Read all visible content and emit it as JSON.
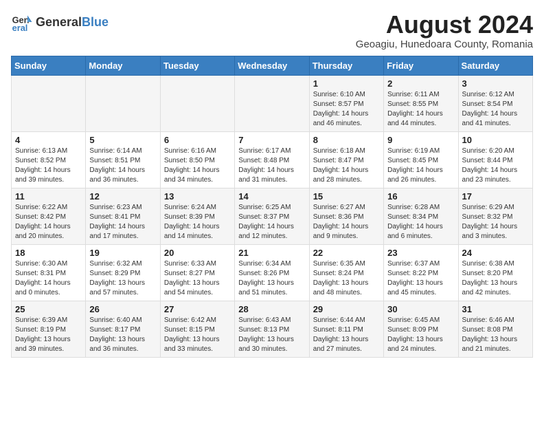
{
  "header": {
    "logo_general": "General",
    "logo_blue": "Blue",
    "month_year": "August 2024",
    "location": "Geoagiu, Hunedoara County, Romania"
  },
  "weekdays": [
    "Sunday",
    "Monday",
    "Tuesday",
    "Wednesday",
    "Thursday",
    "Friday",
    "Saturday"
  ],
  "weeks": [
    [
      {
        "day": "",
        "info": ""
      },
      {
        "day": "",
        "info": ""
      },
      {
        "day": "",
        "info": ""
      },
      {
        "day": "",
        "info": ""
      },
      {
        "day": "1",
        "info": "Sunrise: 6:10 AM\nSunset: 8:57 PM\nDaylight: 14 hours\nand 46 minutes."
      },
      {
        "day": "2",
        "info": "Sunrise: 6:11 AM\nSunset: 8:55 PM\nDaylight: 14 hours\nand 44 minutes."
      },
      {
        "day": "3",
        "info": "Sunrise: 6:12 AM\nSunset: 8:54 PM\nDaylight: 14 hours\nand 41 minutes."
      }
    ],
    [
      {
        "day": "4",
        "info": "Sunrise: 6:13 AM\nSunset: 8:52 PM\nDaylight: 14 hours\nand 39 minutes."
      },
      {
        "day": "5",
        "info": "Sunrise: 6:14 AM\nSunset: 8:51 PM\nDaylight: 14 hours\nand 36 minutes."
      },
      {
        "day": "6",
        "info": "Sunrise: 6:16 AM\nSunset: 8:50 PM\nDaylight: 14 hours\nand 34 minutes."
      },
      {
        "day": "7",
        "info": "Sunrise: 6:17 AM\nSunset: 8:48 PM\nDaylight: 14 hours\nand 31 minutes."
      },
      {
        "day": "8",
        "info": "Sunrise: 6:18 AM\nSunset: 8:47 PM\nDaylight: 14 hours\nand 28 minutes."
      },
      {
        "day": "9",
        "info": "Sunrise: 6:19 AM\nSunset: 8:45 PM\nDaylight: 14 hours\nand 26 minutes."
      },
      {
        "day": "10",
        "info": "Sunrise: 6:20 AM\nSunset: 8:44 PM\nDaylight: 14 hours\nand 23 minutes."
      }
    ],
    [
      {
        "day": "11",
        "info": "Sunrise: 6:22 AM\nSunset: 8:42 PM\nDaylight: 14 hours\nand 20 minutes."
      },
      {
        "day": "12",
        "info": "Sunrise: 6:23 AM\nSunset: 8:41 PM\nDaylight: 14 hours\nand 17 minutes."
      },
      {
        "day": "13",
        "info": "Sunrise: 6:24 AM\nSunset: 8:39 PM\nDaylight: 14 hours\nand 14 minutes."
      },
      {
        "day": "14",
        "info": "Sunrise: 6:25 AM\nSunset: 8:37 PM\nDaylight: 14 hours\nand 12 minutes."
      },
      {
        "day": "15",
        "info": "Sunrise: 6:27 AM\nSunset: 8:36 PM\nDaylight: 14 hours\nand 9 minutes."
      },
      {
        "day": "16",
        "info": "Sunrise: 6:28 AM\nSunset: 8:34 PM\nDaylight: 14 hours\nand 6 minutes."
      },
      {
        "day": "17",
        "info": "Sunrise: 6:29 AM\nSunset: 8:32 PM\nDaylight: 14 hours\nand 3 minutes."
      }
    ],
    [
      {
        "day": "18",
        "info": "Sunrise: 6:30 AM\nSunset: 8:31 PM\nDaylight: 14 hours\nand 0 minutes."
      },
      {
        "day": "19",
        "info": "Sunrise: 6:32 AM\nSunset: 8:29 PM\nDaylight: 13 hours\nand 57 minutes."
      },
      {
        "day": "20",
        "info": "Sunrise: 6:33 AM\nSunset: 8:27 PM\nDaylight: 13 hours\nand 54 minutes."
      },
      {
        "day": "21",
        "info": "Sunrise: 6:34 AM\nSunset: 8:26 PM\nDaylight: 13 hours\nand 51 minutes."
      },
      {
        "day": "22",
        "info": "Sunrise: 6:35 AM\nSunset: 8:24 PM\nDaylight: 13 hours\nand 48 minutes."
      },
      {
        "day": "23",
        "info": "Sunrise: 6:37 AM\nSunset: 8:22 PM\nDaylight: 13 hours\nand 45 minutes."
      },
      {
        "day": "24",
        "info": "Sunrise: 6:38 AM\nSunset: 8:20 PM\nDaylight: 13 hours\nand 42 minutes."
      }
    ],
    [
      {
        "day": "25",
        "info": "Sunrise: 6:39 AM\nSunset: 8:19 PM\nDaylight: 13 hours\nand 39 minutes."
      },
      {
        "day": "26",
        "info": "Sunrise: 6:40 AM\nSunset: 8:17 PM\nDaylight: 13 hours\nand 36 minutes."
      },
      {
        "day": "27",
        "info": "Sunrise: 6:42 AM\nSunset: 8:15 PM\nDaylight: 13 hours\nand 33 minutes."
      },
      {
        "day": "28",
        "info": "Sunrise: 6:43 AM\nSunset: 8:13 PM\nDaylight: 13 hours\nand 30 minutes."
      },
      {
        "day": "29",
        "info": "Sunrise: 6:44 AM\nSunset: 8:11 PM\nDaylight: 13 hours\nand 27 minutes."
      },
      {
        "day": "30",
        "info": "Sunrise: 6:45 AM\nSunset: 8:09 PM\nDaylight: 13 hours\nand 24 minutes."
      },
      {
        "day": "31",
        "info": "Sunrise: 6:46 AM\nSunset: 8:08 PM\nDaylight: 13 hours\nand 21 minutes."
      }
    ]
  ]
}
